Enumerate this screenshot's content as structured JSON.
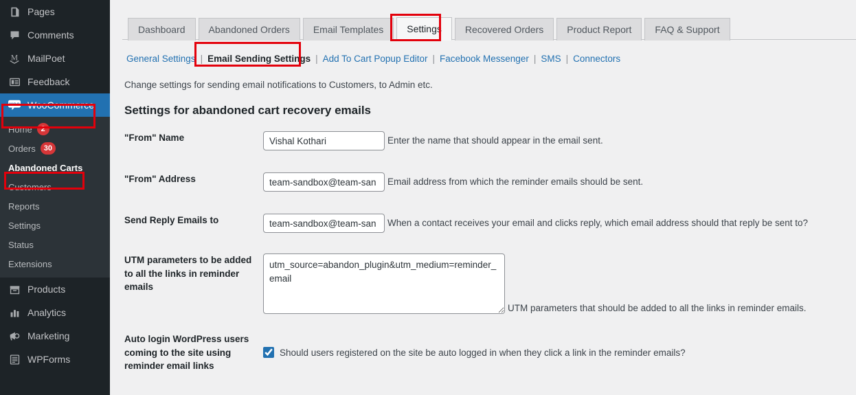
{
  "sidebar": {
    "items": [
      {
        "label": "Pages",
        "icon": "pages-icon"
      },
      {
        "label": "Comments",
        "icon": "comments-icon"
      },
      {
        "label": "MailPoet",
        "icon": "mailpoet-icon"
      },
      {
        "label": "Feedback",
        "icon": "feedback-icon"
      },
      {
        "label": "WooCommerce",
        "icon": "woocommerce-icon",
        "current": true
      },
      {
        "label": "Products",
        "icon": "products-icon"
      },
      {
        "label": "Analytics",
        "icon": "analytics-icon"
      },
      {
        "label": "Marketing",
        "icon": "marketing-icon"
      },
      {
        "label": "WPForms",
        "icon": "wpforms-icon"
      }
    ],
    "submenu": [
      {
        "label": "Home",
        "badge": "2"
      },
      {
        "label": "Orders",
        "badge": "30"
      },
      {
        "label": "Abandoned Carts",
        "active": true
      },
      {
        "label": "Customers"
      },
      {
        "label": "Reports"
      },
      {
        "label": "Settings"
      },
      {
        "label": "Status"
      },
      {
        "label": "Extensions"
      }
    ]
  },
  "tabs": [
    {
      "label": "Dashboard"
    },
    {
      "label": "Abandoned Orders"
    },
    {
      "label": "Email Templates"
    },
    {
      "label": "Settings",
      "active": true
    },
    {
      "label": "Recovered Orders"
    },
    {
      "label": "Product Report"
    },
    {
      "label": "FAQ & Support"
    }
  ],
  "subtabs": [
    {
      "label": "General Settings"
    },
    {
      "label": "Email Sending Settings",
      "active": true
    },
    {
      "label": "Add To Cart Popup Editor"
    },
    {
      "label": "Facebook Messenger"
    },
    {
      "label": "SMS"
    },
    {
      "label": "Connectors"
    }
  ],
  "page": {
    "intro": "Change settings for sending email notifications to Customers, to Admin etc.",
    "section_title": "Settings for abandoned cart recovery emails"
  },
  "form": {
    "from_name": {
      "label": "\"From\" Name",
      "value": "Vishal Kothari",
      "help": "Enter the name that should appear in the email sent."
    },
    "from_address": {
      "label": "\"From\" Address",
      "value": "team-sandbox@team-san",
      "help": "Email address from which the reminder emails should be sent."
    },
    "reply_to": {
      "label": "Send Reply Emails to",
      "value": "team-sandbox@team-san",
      "help": "When a contact receives your email and clicks reply, which email address should that reply be sent to?"
    },
    "utm": {
      "label": "UTM parameters to be added to all the links in reminder emails",
      "value": "utm_source=abandon_plugin&utm_medium=reminder_email",
      "help": "UTM parameters that should be added to all the links in reminder emails."
    },
    "auto_login": {
      "label": "Auto login WordPress users coming to the site using reminder email links",
      "checkbox_label": "Should users registered on the site be auto logged in when they click a link in the reminder emails?",
      "checked": true
    }
  },
  "colors": {
    "sidebar_bg": "#1d2327",
    "submenu_bg": "#2c3338",
    "accent_blue": "#2271b1",
    "badge_red": "#d63638",
    "annotation_red": "#e3000b",
    "content_bg": "#f0f0f1"
  }
}
